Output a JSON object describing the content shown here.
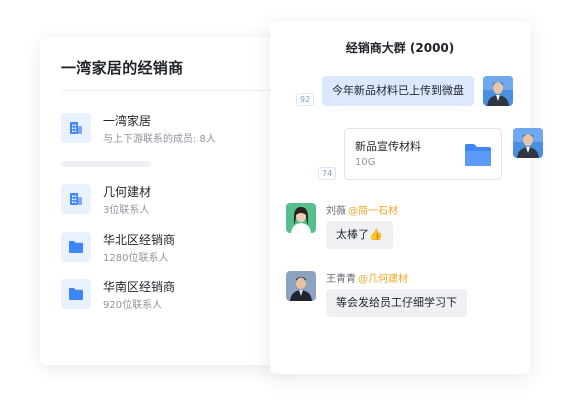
{
  "left_panel": {
    "title": "一湾家居的经销商",
    "orgs": [
      {
        "name": "一湾家居",
        "subtitle": "与上下游联系的成员: 8人",
        "icon": "building-icon"
      },
      {
        "name": "几何建材",
        "subtitle": "3位联系人",
        "icon": "building-icon"
      },
      {
        "name": "华北区经销商",
        "subtitle": "1280位联系人",
        "icon": "folder-icon"
      },
      {
        "name": "华南区经销商",
        "subtitle": "920位联系人",
        "icon": "folder-icon"
      }
    ]
  },
  "chat": {
    "title": "经销商大群 (2000)",
    "messages": [
      {
        "type": "text",
        "from_me": true,
        "text": "今年新品材料已上传到微盘",
        "read_count": "92"
      },
      {
        "type": "file",
        "from_me": true,
        "file_name": "新品宣传材料",
        "file_size": "10G",
        "read_count": "74"
      },
      {
        "type": "text",
        "from_me": false,
        "sender": "刘薇",
        "sender_org": "@简一石材",
        "text": "太棒了👍"
      },
      {
        "type": "text",
        "from_me": false,
        "sender": "王青青",
        "sender_org": "@几何建材",
        "text": "等会发给员工仔细学习下"
      }
    ]
  },
  "colors": {
    "accent": "#3e85f5",
    "icon_bg": "#e9f1fe",
    "my_bubble": "#dbe8fd",
    "other_bubble": "#eef0f3",
    "org_tag": "#f5a623"
  }
}
